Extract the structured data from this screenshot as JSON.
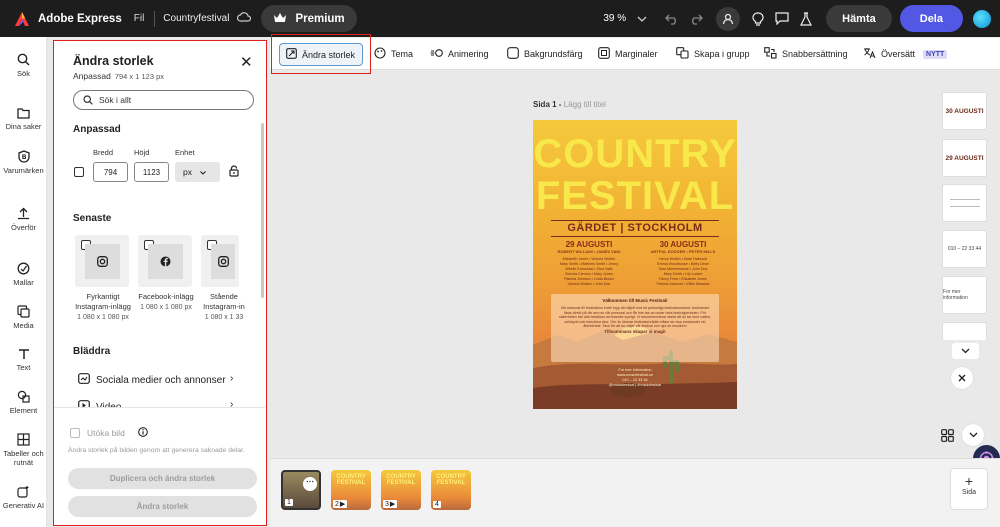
{
  "topbar": {
    "app_name": "Adobe Express",
    "file_menu": "Fil",
    "doc_title": "Countryfestival",
    "premium_label": "Premium",
    "zoom": "39 %",
    "download_label": "Hämta",
    "share_label": "Dela"
  },
  "rail": [
    {
      "label": "Sök",
      "icon": "search-icon"
    },
    {
      "label": "Dina saker",
      "icon": "folder-icon"
    },
    {
      "label": "Varumärken",
      "icon": "brand-icon"
    },
    {
      "label": "Överför",
      "icon": "upload-icon"
    },
    {
      "label": "Mallar",
      "icon": "templates-icon"
    },
    {
      "label": "Media",
      "icon": "media-icon"
    },
    {
      "label": "Text",
      "icon": "text-icon"
    },
    {
      "label": "Element",
      "icon": "elements-icon"
    },
    {
      "label": "Tabeller och rutnät",
      "icon": "grid-icon"
    },
    {
      "label": "Generativ AI",
      "icon": "ai-icon"
    }
  ],
  "panel": {
    "title": "Ändra storlek",
    "subtitle": "Anpassad",
    "dims": "794 x 1 123 px",
    "search_placeholder": "Sök i allt",
    "custom_heading": "Anpassad",
    "width_label": "Bredd",
    "height_label": "Höjd",
    "unit_label": "Enhet",
    "width_value": "794",
    "height_value": "1123",
    "unit_value": "px",
    "recent_heading": "Senaste",
    "recent": [
      {
        "line1": "Fyrkantigt",
        "line2": "Instagram-inlägg",
        "size": "1 080 x 1 080 px"
      },
      {
        "line1": "Facebook-inlägg",
        "line2": "",
        "size": "1 080 x 1 080 px"
      },
      {
        "line1": "Stående",
        "line2": "Instagram-in",
        "size": "1 080 x 1 33"
      }
    ],
    "browse_heading": "Bläddra",
    "browse": [
      "Sociala medier och annonser",
      "Video"
    ],
    "expand_label": "Utöka bild",
    "expand_note": "Ändra storlek på bilden genom att generera saknade delar.",
    "duplicate_button": "Duplicera och ändra storlek",
    "resize_button": "Ändra storlek"
  },
  "toolbar": {
    "resize": "Ändra storlek",
    "theme": "Tema",
    "animation": "Animering",
    "background": "Bakgrundsfärg",
    "margins": "Marginaler",
    "group": "Skapa i grupp",
    "shortcuts": "Snabbersättning",
    "translate": "Översätt",
    "new_badge": "NYTT"
  },
  "canvas": {
    "page_label": "Sida 1 - ",
    "page_hint": "Lägg till titel"
  },
  "poster": {
    "title1": "COUNTRY",
    "title2": "FESTIVAL",
    "location": "GÄRDET | STOCKHOLM",
    "date_left": "29 AUGUSTI",
    "date_right": "30 AUGUSTI",
    "sub_left": "ROBERT WILLIAM • JAMES VANI",
    "sub_right": "ARTFUL DODGER • PETER MILLS",
    "names_left": [
      "Elizabeth Jones • Victoria Wotten",
      "Mary Smith • Matthew Smith • Jenny",
      "Windle Earnshaw • Shut Valle",
      "Brenda Carmon • Mary Jones",
      "Patricia Johnson • Linda Brown",
      "Victoria Wotten • John Doe"
    ],
    "names_right": [
      "Henry Wotten • Basil Hallward",
      "Emma Woodhouse • Betty Dean",
      "Sara Mermekstone • John Doe",
      "Mary Smith • Lily Lucker",
      "Fanny Price • Elizabeth Jones",
      "Patricia Johnson • Willie Meadow"
    ],
    "box_title": "Välkommen till Music Festival!",
    "box_text": "Vid ankomst till festivalens entré kryp din biljett mot ett personligt festivalarmband. Armbandet fästs direkt på din arm av vår personal och får inte tas av under hela festivalperioden. För säkerheten bär alla besökare armbandet synligt. Vi rekommenderar starkt att du tar med vatten, solskydd och bekväma skor. Om du lämnar festivalområdet måste du visa armbandet vid återinträde. Tack för att du väljer vår festival och njut av musiken!",
    "box_end": "Tillsammans skapar vi magi!",
    "footer": [
      "For mer information",
      "www.musicfestival.se",
      "010 – 22 33 44",
      "@musicfestival | #musicfestival"
    ]
  },
  "right_thumbs": [
    "30 AUGUSTI",
    "29 AUGUSTI",
    "",
    "010 – 22 33 44",
    "For mer information"
  ],
  "strip": {
    "pages": [
      "1",
      "2",
      "3",
      "4"
    ],
    "thumb_title": "COUNTRY FESTIVAL",
    "add_label": "Sida"
  }
}
